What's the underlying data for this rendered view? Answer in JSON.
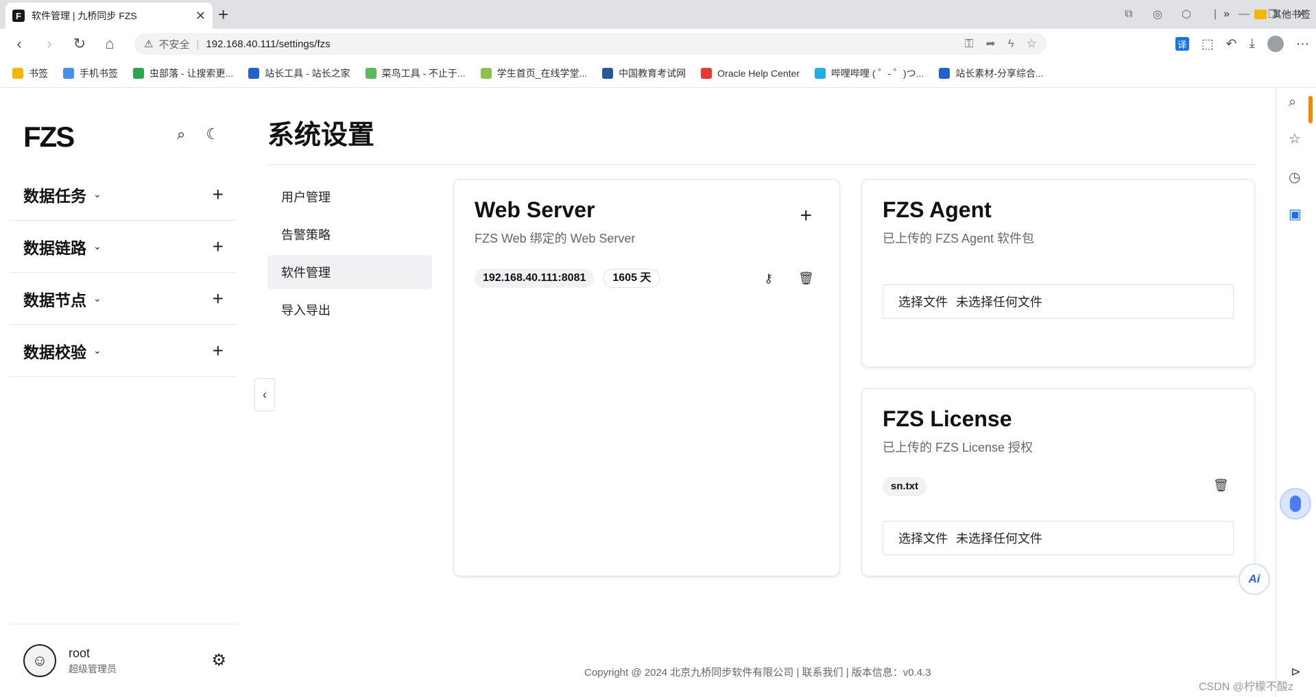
{
  "browser": {
    "tab_title": "软件管理 | 九桥同步 FZS",
    "tab_favicon": "F",
    "insecure_label": "不安全",
    "url": "192.168.40.111/settings/fzs",
    "translate_label": "译",
    "bookmarks": [
      {
        "label": "书签",
        "color": "#f2b800"
      },
      {
        "label": "手机书签",
        "color": "#4a90e2"
      },
      {
        "label": "虫部落 - 让搜索更...",
        "color": "#2ea44f"
      },
      {
        "label": "站长工具 - 站长之家",
        "color": "#2062c9"
      },
      {
        "label": "菜鸟工具 - 不止于...",
        "color": "#5cb85c"
      },
      {
        "label": "学生首页_在线学堂...",
        "color": "#8bc34a"
      },
      {
        "label": "中国教育考试网",
        "color": "#2b5797"
      },
      {
        "label": "Oracle Help Center",
        "color": "#e53935"
      },
      {
        "label": "哔哩哔哩 ( ゜- ゜)つ...",
        "color": "#23ade5"
      },
      {
        "label": "站长素材-分享综合...",
        "color": "#2062c9"
      }
    ],
    "bookmarks_more": "»",
    "other_bookmarks": "其他书签"
  },
  "app": {
    "logo": "FZS",
    "nav": [
      {
        "label": "数据任务"
      },
      {
        "label": "数据链路"
      },
      {
        "label": "数据节点"
      },
      {
        "label": "数据校验"
      }
    ],
    "user": {
      "name": "root",
      "role": "超级管理员"
    }
  },
  "page": {
    "title": "系统设置",
    "menu": [
      {
        "label": "用户管理",
        "active": false
      },
      {
        "label": "告警策略",
        "active": false
      },
      {
        "label": "软件管理",
        "active": true
      },
      {
        "label": "导入导出",
        "active": false
      }
    ]
  },
  "web_server": {
    "title": "Web Server",
    "subtitle": "FZS Web 绑定的 Web Server",
    "address": "192.168.40.111:8081",
    "days": "1605 天"
  },
  "agent": {
    "title": "FZS Agent",
    "subtitle": "已上传的 FZS Agent 软件包",
    "choose_file": "选择文件",
    "no_file": "未选择任何文件"
  },
  "license": {
    "title": "FZS License",
    "subtitle": "已上传的 FZS License 授权",
    "file": "sn.txt",
    "choose_file": "选择文件",
    "no_file": "未选择任何文件"
  },
  "footer": "Copyright @ 2024 北京九桥同步软件有限公司 | 联系我们 | 版本信息：v0.4.3",
  "watermark": "CSDN @柠檬不酸z"
}
